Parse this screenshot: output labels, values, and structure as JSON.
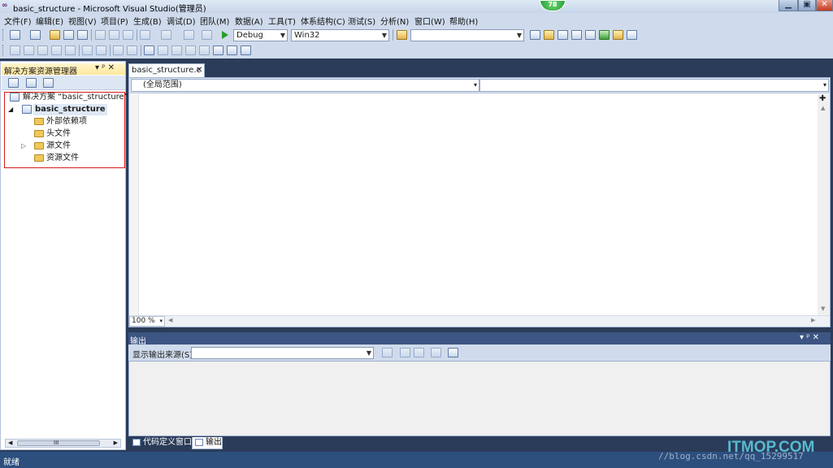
{
  "window": {
    "title": "basic_structure - Microsoft Visual Studio(管理员)",
    "badge": "78",
    "min": "▁",
    "max": "▣",
    "close": "✕"
  },
  "menu": [
    "文件(F)",
    "编辑(E)",
    "视图(V)",
    "项目(P)",
    "生成(B)",
    "调试(D)",
    "团队(M)",
    "数据(A)",
    "工具(T)",
    "体系结构(C)",
    "测试(S)",
    "分析(N)",
    "窗口(W)",
    "帮助(H)"
  ],
  "toolbar": {
    "config": "Debug",
    "platform": "Win32",
    "find": ""
  },
  "solution_explorer": {
    "title": "解决方案资源管理器",
    "pin": "▾ ᵖ ✕",
    "solution": "解决方案 “basic_structure” (1",
    "project": "basic_structure",
    "folders": [
      "外部依赖项",
      "头文件",
      "源文件",
      "资源文件"
    ],
    "scroll_mark": "III"
  },
  "editor": {
    "tab": "basic_structure.c",
    "tab_close": "✕",
    "scope": "(全局范围)",
    "member": "",
    "zoom": "100 %"
  },
  "output": {
    "title": "输出",
    "source_label": "显示输出来源(S):",
    "source_value": "",
    "controls": "▾ ᵖ ✕"
  },
  "bottom_tabs": [
    "代码定义窗口",
    "输出"
  ],
  "status": "就绪",
  "watermark": "//blog.csdn.net/qq_15299517",
  "watermark2": "ITMOP.COM",
  "colors": {
    "title_bg": "#c7d6ea",
    "panel_head": "#ffe79b",
    "status_bg": "#2c4f7e",
    "highlight": "#d61b1b"
  }
}
